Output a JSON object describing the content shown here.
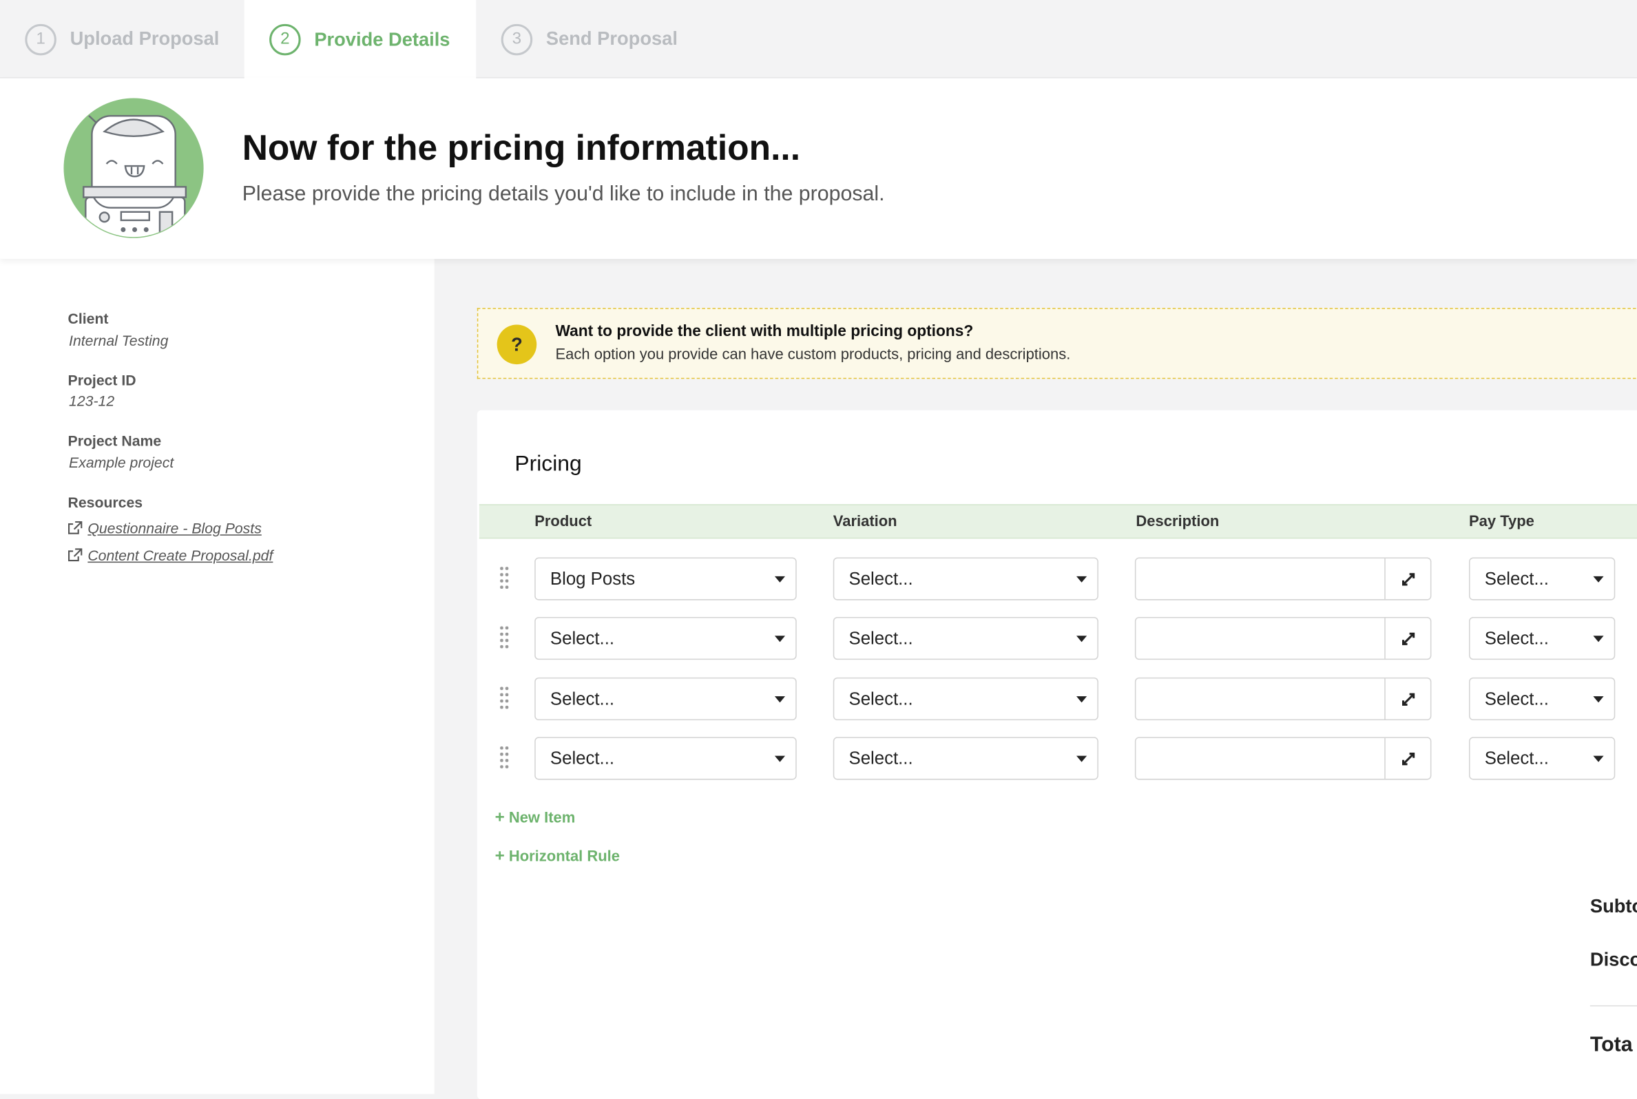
{
  "steps": [
    {
      "num": "1",
      "label": "Upload Proposal",
      "state": "inactive"
    },
    {
      "num": "2",
      "label": "Provide Details",
      "state": "active"
    },
    {
      "num": "3",
      "label": "Send Proposal",
      "state": "inactive"
    }
  ],
  "hero": {
    "title": "Now for the pricing information...",
    "subtitle": "Please provide the pricing details you'd like to include in the proposal."
  },
  "sidebar": {
    "client_label": "Client",
    "client_value": "Internal Testing",
    "project_id_label": "Project ID",
    "project_id_value": "123-12",
    "project_name_label": "Project Name",
    "project_name_value": "Example project",
    "resources_label": "Resources",
    "resources": [
      "Questionnaire - Blog Posts",
      "Content Create Proposal.pdf"
    ]
  },
  "banner": {
    "icon": "?",
    "title": "Want to provide the client with multiple pricing options?",
    "text": "Each option you provide can have custom products, pricing and descriptions."
  },
  "pricing": {
    "title": "Pricing",
    "columns": {
      "product": "Product",
      "variation": "Variation",
      "description": "Description",
      "pay_type": "Pay Type"
    },
    "rows": [
      {
        "product": "Blog Posts",
        "variation": "Select...",
        "description": "",
        "pay_type": "Select..."
      },
      {
        "product": "Select...",
        "variation": "Select...",
        "description": "",
        "pay_type": "Select..."
      },
      {
        "product": "Select...",
        "variation": "Select...",
        "description": "",
        "pay_type": "Select..."
      },
      {
        "product": "Select...",
        "variation": "Select...",
        "description": "",
        "pay_type": "Select..."
      }
    ],
    "new_item": "New Item",
    "horizontal_rule": "Horizontal Rule",
    "subtotal_label": "Subto",
    "discount_label": "Disco",
    "total_label": "Tota"
  },
  "colors": {
    "accent": "#6db36d",
    "banner_bg": "#fcf9e9",
    "banner_border": "#e2c23a",
    "header_row": "#e7f2e4"
  }
}
